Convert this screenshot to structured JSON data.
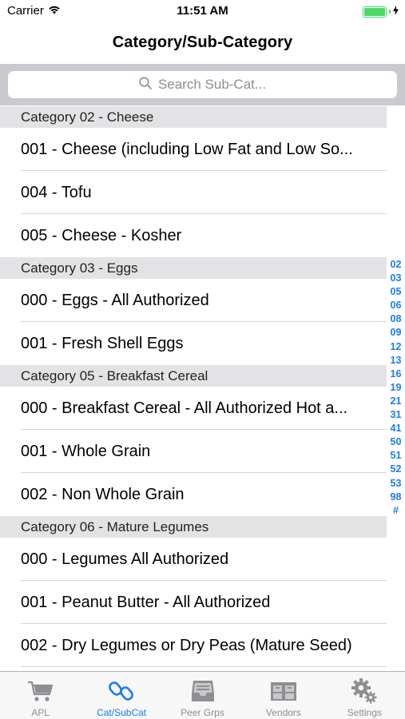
{
  "status_bar": {
    "carrier": "Carrier",
    "time": "11:51 AM"
  },
  "nav": {
    "title": "Category/Sub-Category"
  },
  "search": {
    "placeholder": "Search Sub-Cat..."
  },
  "sections": [
    {
      "header": "Category 02 - Cheese",
      "rows": [
        "001 - Cheese (including Low Fat and Low So...",
        "004 - Tofu",
        "005 - Cheese - Kosher"
      ]
    },
    {
      "header": "Category 03 - Eggs",
      "rows": [
        "000 - Eggs - All Authorized",
        "001 - Fresh Shell Eggs"
      ]
    },
    {
      "header": "Category 05 - Breakfast Cereal",
      "rows": [
        "000 - Breakfast Cereal - All Authorized Hot a...",
        "001 - Whole Grain",
        "002 - Non Whole Grain"
      ]
    },
    {
      "header": "Category 06 - Mature Legumes",
      "rows": [
        "000 - Legumes All Authorized",
        "001 - Peanut Butter - All Authorized",
        "002 - Dry Legumes or Dry Peas (Mature Seed)"
      ]
    }
  ],
  "index": [
    "02",
    "03",
    "05",
    "06",
    "08",
    "09",
    "12",
    "13",
    "16",
    "19",
    "21",
    "31",
    "41",
    "50",
    "51",
    "52",
    "53",
    "98",
    "#"
  ],
  "tabs": [
    {
      "label": "APL",
      "icon": "cart-icon",
      "active": false
    },
    {
      "label": "Cat/SubCat",
      "icon": "link-icon",
      "active": true
    },
    {
      "label": "Peer Grps",
      "icon": "inbox-icon",
      "active": false
    },
    {
      "label": "Vendors",
      "icon": "store-icon",
      "active": false
    },
    {
      "label": "Settings",
      "icon": "gears-icon",
      "active": false
    }
  ],
  "colors": {
    "accent": "#1a7cf5",
    "battery": "#4cd964",
    "section_header_bg": "#e3e3e6",
    "search_bar_bg": "#c9c9ce"
  }
}
